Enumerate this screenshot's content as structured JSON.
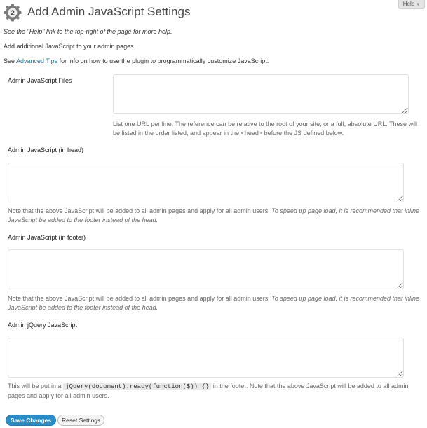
{
  "header": {
    "help_tab_label": "Help",
    "icon_badge": "2",
    "title": "Add Admin JavaScript Settings"
  },
  "intro": {
    "help_note": "See the \"Help\" link to the top-right of the page for more help.",
    "description": "Add additional JavaScript to your admin pages.",
    "tips_prefix": "See ",
    "tips_link": "Advanced Tips",
    "tips_suffix": " for info on how to use the plugin to programmatically customize JavaScript."
  },
  "fields": {
    "files": {
      "label": "Admin JavaScript Files",
      "description": "List one URL per line. The reference can be relative to the root of your site, or a full, absolute URL. These will be listed in the order listed, and appear in the <head> before the JS defined below."
    },
    "head": {
      "label": "Admin JavaScript (in head)",
      "description": "Note that the above JavaScript will be added to all admin pages and apply for all admin users. ",
      "description_italic": "To speed up page load, it is recommended that inline JavaScript be added to the footer instead of the head."
    },
    "footer": {
      "label": "Admin JavaScript (in footer)",
      "description": "Note that the above JavaScript will be added to all admin pages and apply for all admin users. ",
      "description_italic": "To speed up page load, it is recommended that inline JavaScript be added to the footer instead of the head."
    },
    "jquery": {
      "label": "Admin jQuery JavaScript",
      "description_prefix": "This will be put in a ",
      "code": "jQuery(document).ready(function($)) {}",
      "description_suffix": " in the footer. Note that the above JavaScript will be added to all admin pages and apply for all admin users."
    }
  },
  "buttons": {
    "save": "Save Changes",
    "reset": "Reset Settings"
  },
  "colors": {
    "primary_button": "#2a8cc7",
    "link": "#21759b"
  }
}
